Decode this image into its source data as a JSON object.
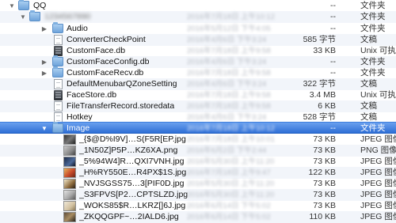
{
  "rows": [
    {
      "name": "QQ",
      "date": "",
      "size": "--",
      "kind": "文件夹",
      "icon": "folder-icon"
    },
    {
      "name": "1234567890",
      "date": "2016年7月18日 上午10:12",
      "size": "--",
      "kind": "文件夹",
      "icon": "folder-icon"
    },
    {
      "name": "Audio",
      "date": "2016年5月12日 下午4:05",
      "size": "--",
      "kind": "文件夹",
      "icon": "folder-icon"
    },
    {
      "name": "ConverterCheckPoint",
      "date": "2016年4月6日 下午3:24",
      "size": "585 字节",
      "kind": "文稿",
      "icon": "document-icon"
    },
    {
      "name": "CustomFace.db",
      "date": "2016年7月18日 上午9:58",
      "size": "33 KB",
      "kind": "Unix 可执行",
      "icon": "database-icon"
    },
    {
      "name": "CustomFaceConfig.db",
      "date": "2016年4月6日 下午3:24",
      "size": "--",
      "kind": "文件夹",
      "icon": "folder-icon"
    },
    {
      "name": "CustomFaceRecv.db",
      "date": "2016年7月18日 上午9:58",
      "size": "--",
      "kind": "文件夹",
      "icon": "folder-icon"
    },
    {
      "name": "DefaultMenubarQZoneSetting",
      "date": "2016年4月6日 下午3:24",
      "size": "322 字节",
      "kind": "文稿",
      "icon": "document-icon"
    },
    {
      "name": "FaceStore.db",
      "date": "2016年7月18日 上午9:58",
      "size": "3.4 MB",
      "kind": "Unix 可执行",
      "icon": "database-icon"
    },
    {
      "name": "FileTransferRecord.storedata",
      "date": "2016年7月18日 上午9:58",
      "size": "6 KB",
      "kind": "文稿",
      "icon": "document-icon"
    },
    {
      "name": "Hotkey",
      "date": "2016年4月6日 下午3:24",
      "size": "528 字节",
      "kind": "文稿",
      "icon": "document-icon"
    },
    {
      "name": "Image",
      "date": "2016年7月18日 上午10:12",
      "size": "--",
      "kind": "文件夹",
      "icon": "folder-icon"
    },
    {
      "name": "_{$@D%I9V]…S(F5R[EP.jpg",
      "date": "2016年7月18日 上午10:01",
      "size": "73 KB",
      "kind": "JPEG 图像",
      "icon": "jpeg-thumbnail-icon"
    },
    {
      "name": "_1N50Z]P5P…KZ6XA.png",
      "date": "2016年6月2日 下午2:44",
      "size": "73 KB",
      "kind": "PNG 图像",
      "icon": "png-thumbnail-icon"
    },
    {
      "name": "_5%94W4]R…QXI7VNH.jpg",
      "date": "2016年5月30日 上午11:20",
      "size": "73 KB",
      "kind": "JPEG 图像",
      "icon": "jpeg-thumbnail-icon"
    },
    {
      "name": "_H%RY550E…R4PX$1S.jpg",
      "date": "2016年7月18日 上午9:47",
      "size": "122 KB",
      "kind": "JPEG 图像",
      "icon": "jpeg-thumbnail-icon"
    },
    {
      "name": "_NVJSGSS75…3[PIF0D.jpg",
      "date": "2016年5月30日 上午11:20",
      "size": "73 KB",
      "kind": "JPEG 图像",
      "icon": "jpeg-thumbnail-icon"
    },
    {
      "name": "_S3FPVS[P2…CPTSLZD.jpg",
      "date": "2016年5月30日 上午11:20",
      "size": "73 KB",
      "kind": "JPEG 图像",
      "icon": "jpeg-thumbnail-icon"
    },
    {
      "name": "_WOKS85$R…LKRZ[]6J.jpg",
      "date": "2016年6月14日 下午5:02",
      "size": "73 KB",
      "kind": "JPEG 图像",
      "icon": "jpeg-thumbnail-icon"
    },
    {
      "name": "_ZKQQGPF~…2IALD6.jpg",
      "date": "2016年6月14日 下午5:02",
      "size": "110 KB",
      "kind": "JPEG 图像",
      "icon": "jpeg-thumbnail-icon"
    }
  ]
}
